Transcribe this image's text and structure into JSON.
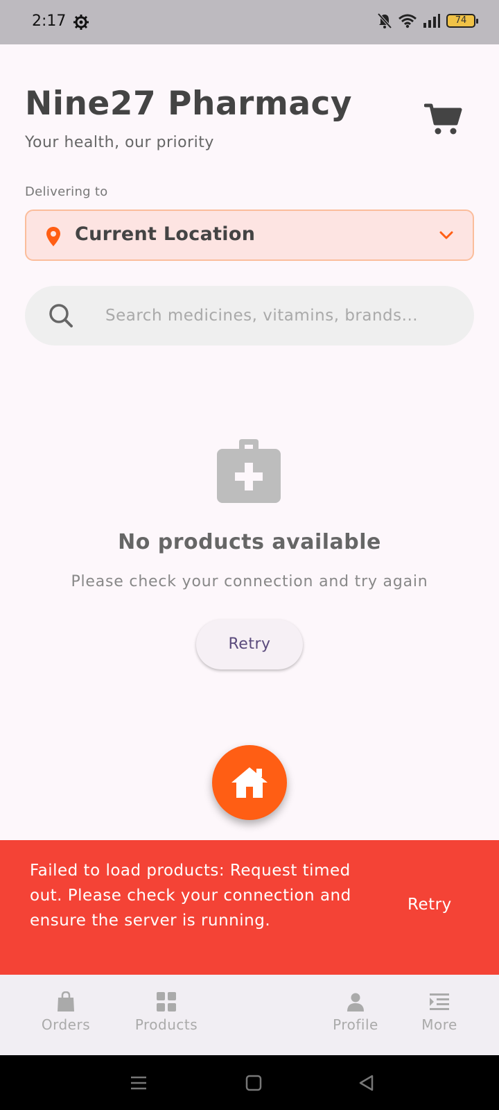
{
  "status_bar": {
    "time": "2:17",
    "battery": "74"
  },
  "header": {
    "title": "Nine27 Pharmacy",
    "subtitle": "Your health, our priority"
  },
  "delivery": {
    "label": "Delivering to",
    "location": "Current Location"
  },
  "search": {
    "placeholder": "Search medicines, vitamins, brands..."
  },
  "empty_state": {
    "title": "No products available",
    "subtitle": "Please check your connection and try again",
    "retry_label": "Retry"
  },
  "snackbar": {
    "message": "Failed to load products: Request timed out. Please check your connection and ensure the server is running.",
    "action_label": "Retry"
  },
  "bottom_nav": {
    "items": [
      {
        "label": "Orders"
      },
      {
        "label": "Products"
      },
      {
        "label": "Profile"
      },
      {
        "label": "More"
      }
    ]
  },
  "colors": {
    "accent": "#ff5e14",
    "error": "#f44336",
    "location_bg": "#fde4e2"
  }
}
